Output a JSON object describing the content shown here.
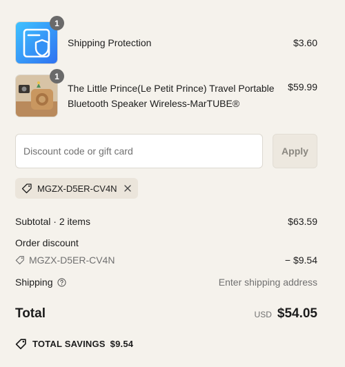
{
  "items": [
    {
      "name": "Shipping Protection",
      "price": "$3.60",
      "quantity": "1",
      "icon": "shield-icon"
    },
    {
      "name": "The Little Prince(Le Petit Prince) Travel Portable Bluetooth Speaker Wireless-MarTUBE®",
      "price": "$59.99",
      "quantity": "1"
    }
  ],
  "discount": {
    "placeholder": "Discount code or gift card",
    "apply_label": "Apply",
    "applied_code": "MGZX-D5ER-CV4N"
  },
  "summary": {
    "subtotal_label": "Subtotal · 2 items",
    "subtotal_value": "$63.59",
    "order_discount_label": "Order discount",
    "order_discount_code": "MGZX-D5ER-CV4N",
    "order_discount_value": "− $9.54",
    "shipping_label": "Shipping",
    "shipping_value": "Enter shipping address",
    "total_label": "Total",
    "total_currency": "USD",
    "total_value": "$54.05",
    "savings_label": "TOTAL SAVINGS",
    "savings_value": "$9.54"
  },
  "colors": {
    "background": "#f5f2ec",
    "shield_gradient_start": "#3fc2ff",
    "shield_gradient_end": "#2f6ff0"
  }
}
